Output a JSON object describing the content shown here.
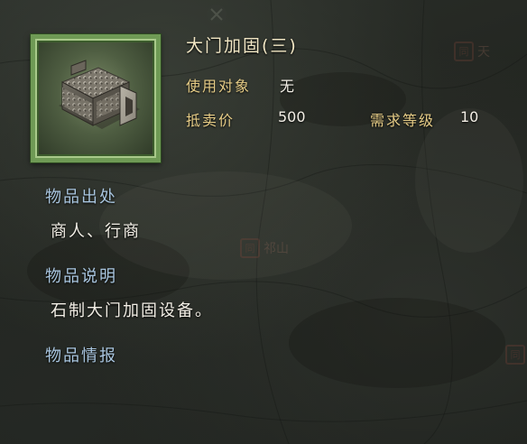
{
  "item": {
    "name": "大门加固(三)",
    "icon": "stone-gate-reinforcement-icon"
  },
  "stats": {
    "target_label": "使用对象",
    "target_value": "无",
    "sell_price_label": "抵卖价",
    "sell_price_value": "500",
    "level_label": "需求等级",
    "level_value": "10"
  },
  "sections": {
    "source": {
      "heading": "物品出处",
      "text": "商人、行商"
    },
    "description": {
      "heading": "物品说明",
      "text": "石制大门加固设备。"
    },
    "intel": {
      "heading": "物品情报"
    }
  },
  "background_markers": [
    {
      "seal": "同",
      "text": "天"
    },
    {
      "seal": "同",
      "text": "祁山"
    },
    {
      "seal": "同",
      "text": ""
    }
  ],
  "colors": {
    "title": "#f1e6c4",
    "label": "#e6cc86",
    "section_heading": "#a9c6e0",
    "value": "#f3efe6",
    "frame": "#6f9a55"
  }
}
